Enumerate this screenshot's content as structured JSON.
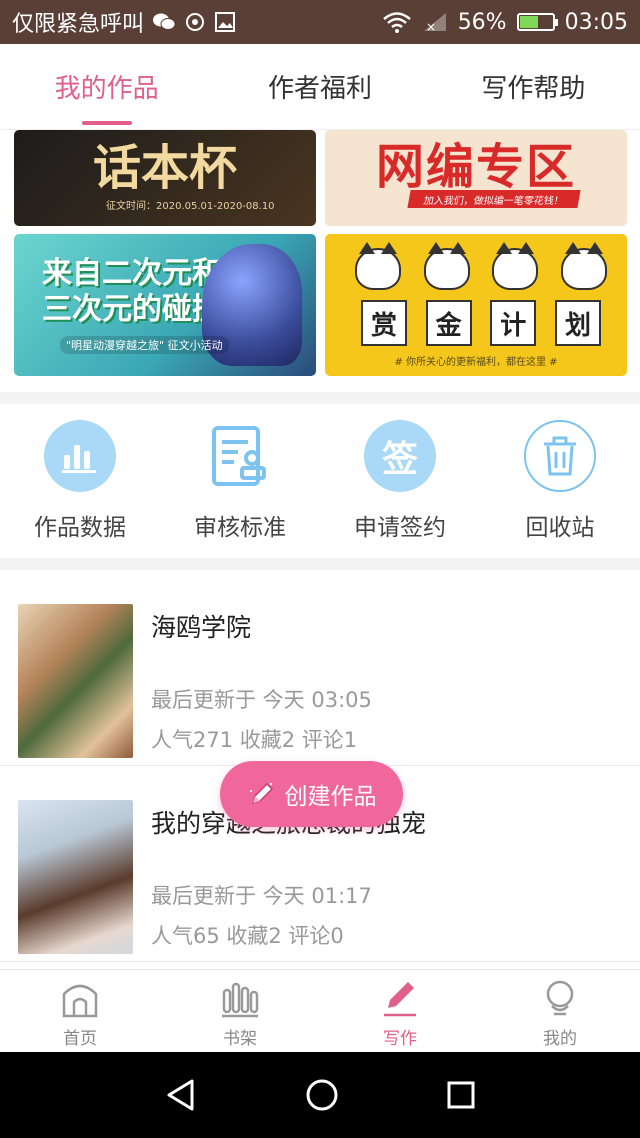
{
  "status_bar": {
    "left_text": "仅限紧急呼叫",
    "battery": "56%",
    "battery_level": 0.56,
    "time": "03:05",
    "icons": [
      "wechat-icon",
      "settings-app-icon",
      "gallery-icon",
      "wifi-icon",
      "no-signal-icon",
      "battery-icon"
    ]
  },
  "top_tabs": [
    {
      "label": "我的作品",
      "active": true
    },
    {
      "label": "作者福利",
      "active": false
    },
    {
      "label": "写作帮助",
      "active": false
    }
  ],
  "banners": {
    "b1": {
      "title": "话本杯",
      "subtitle": "征文时间：2020.05.01-2020-08.10"
    },
    "b2": {
      "title": "网编专区",
      "subtitle": "加入我们，做拟编一笔零花钱！"
    },
    "b3": {
      "title": "来自二次元和三次元的碰撞",
      "subtitle": "\"明星动漫穿越之旅\" 征文小活动"
    },
    "b4": {
      "chars": [
        "赏",
        "金",
        "计",
        "划"
      ],
      "subtitle": "# 你所关心的更新福利，都在这里 #"
    }
  },
  "quick_actions": [
    {
      "label": "作品数据",
      "icon": "bar-chart-icon"
    },
    {
      "label": "审核标准",
      "icon": "review-document-icon"
    },
    {
      "label": "申请签约",
      "icon": "sign-contract-icon",
      "glyph": "签"
    },
    {
      "label": "回收站",
      "icon": "trash-icon"
    }
  ],
  "works": [
    {
      "title": "海鸥学院",
      "updated": "最后更新于 今天 03:05",
      "stats": "人气271  收藏2  评论1"
    },
    {
      "title": "我的穿越之旅总裁的独宠",
      "updated": "最后更新于 今天 01:17",
      "stats": "人气65  收藏2  评论0"
    }
  ],
  "fab": {
    "label": "创建作品"
  },
  "bottom_tabs": [
    {
      "label": "首页",
      "icon": "home-icon",
      "active": false
    },
    {
      "label": "书架",
      "icon": "bookshelf-icon",
      "active": false
    },
    {
      "label": "写作",
      "icon": "pen-icon",
      "active": true
    },
    {
      "label": "我的",
      "icon": "profile-icon",
      "active": false
    }
  ],
  "colors": {
    "accent": "#e0608b",
    "fab": "#f0689b",
    "icon_blue": "#7cc4ef",
    "status_bar": "#5a3f37"
  }
}
